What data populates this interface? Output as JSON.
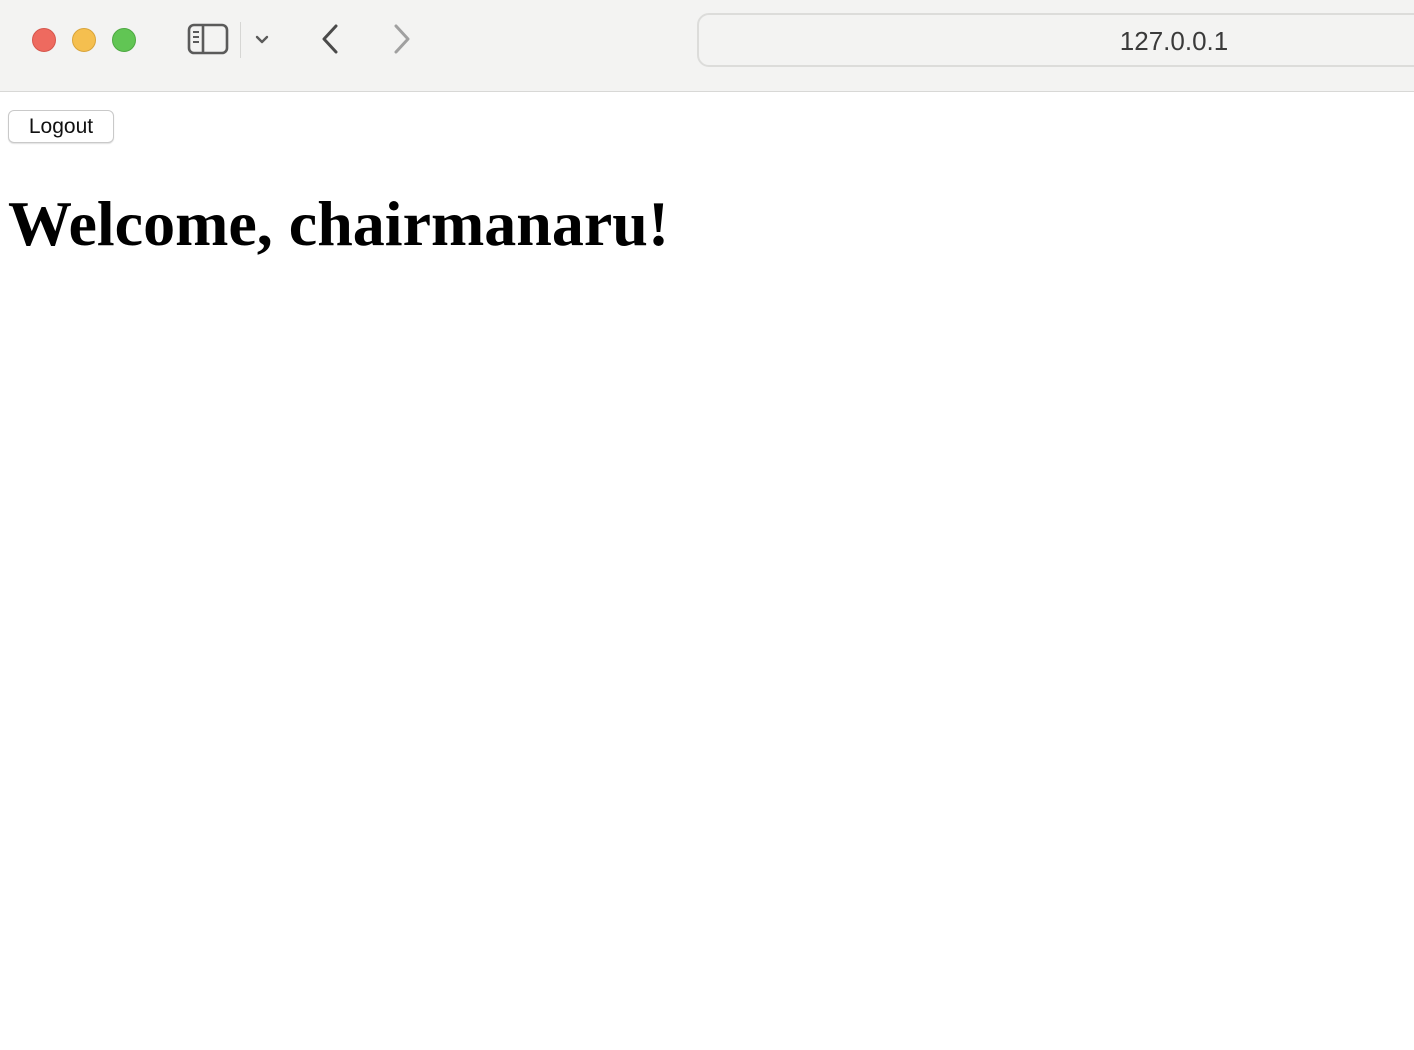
{
  "browser": {
    "address": "127.0.0.1"
  },
  "page": {
    "logout_label": "Logout",
    "heading": "Welcome, chairmanaru!"
  },
  "icons": {
    "sidebar_toggle": "sidebar-icon",
    "tab_overview": "chevron-down-icon",
    "back": "chevron-left-icon",
    "forward": "chevron-right-icon"
  },
  "colors": {
    "close": "#ee6a5f",
    "minimize": "#f5bf4f",
    "maximize": "#61c554",
    "toolbar_bg": "#f3f3f2"
  }
}
